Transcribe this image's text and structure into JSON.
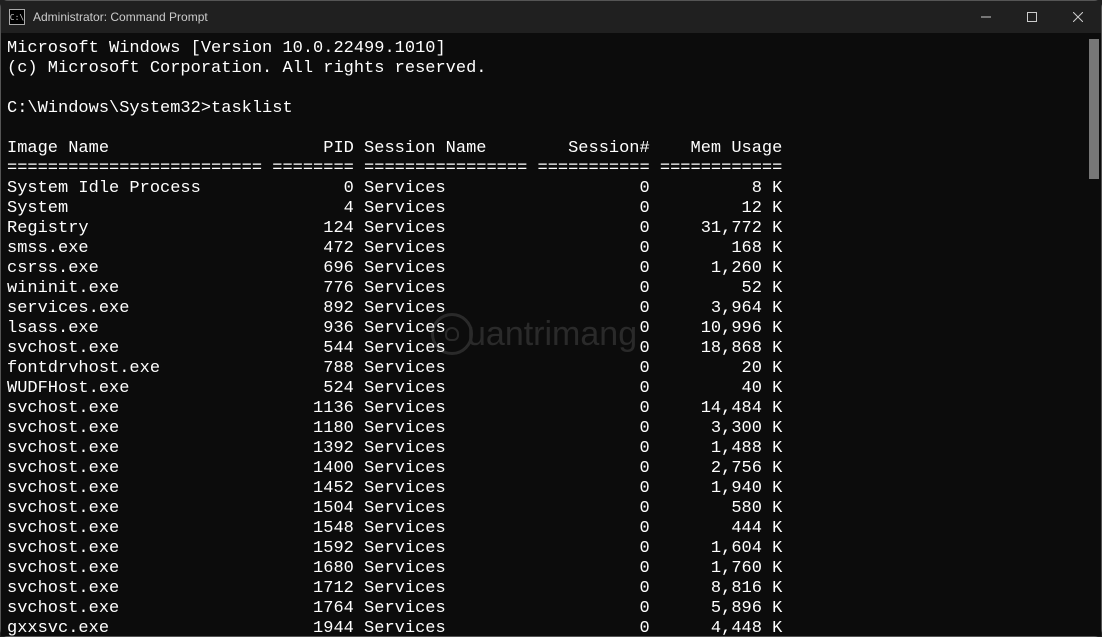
{
  "window": {
    "title": "Administrator: Command Prompt"
  },
  "lines": {
    "version": "Microsoft Windows [Version 10.0.22499.1010]",
    "copyright": "(c) Microsoft Corporation. All rights reserved.",
    "prompt": "C:\\Windows\\System32>",
    "command": "tasklist",
    "header1": "Image Name",
    "header2": "PID",
    "header3": "Session Name",
    "header4": "Session#",
    "header5": "Mem Usage"
  },
  "processes": [
    {
      "name": "System Idle Process",
      "pid": "0",
      "session": "Services",
      "snum": "0",
      "mem": "8 K"
    },
    {
      "name": "System",
      "pid": "4",
      "session": "Services",
      "snum": "0",
      "mem": "12 K"
    },
    {
      "name": "Registry",
      "pid": "124",
      "session": "Services",
      "snum": "0",
      "mem": "31,772 K"
    },
    {
      "name": "smss.exe",
      "pid": "472",
      "session": "Services",
      "snum": "0",
      "mem": "168 K"
    },
    {
      "name": "csrss.exe",
      "pid": "696",
      "session": "Services",
      "snum": "0",
      "mem": "1,260 K"
    },
    {
      "name": "wininit.exe",
      "pid": "776",
      "session": "Services",
      "snum": "0",
      "mem": "52 K"
    },
    {
      "name": "services.exe",
      "pid": "892",
      "session": "Services",
      "snum": "0",
      "mem": "3,964 K"
    },
    {
      "name": "lsass.exe",
      "pid": "936",
      "session": "Services",
      "snum": "0",
      "mem": "10,996 K"
    },
    {
      "name": "svchost.exe",
      "pid": "544",
      "session": "Services",
      "snum": "0",
      "mem": "18,868 K"
    },
    {
      "name": "fontdrvhost.exe",
      "pid": "788",
      "session": "Services",
      "snum": "0",
      "mem": "20 K"
    },
    {
      "name": "WUDFHost.exe",
      "pid": "524",
      "session": "Services",
      "snum": "0",
      "mem": "40 K"
    },
    {
      "name": "svchost.exe",
      "pid": "1136",
      "session": "Services",
      "snum": "0",
      "mem": "14,484 K"
    },
    {
      "name": "svchost.exe",
      "pid": "1180",
      "session": "Services",
      "snum": "0",
      "mem": "3,300 K"
    },
    {
      "name": "svchost.exe",
      "pid": "1392",
      "session": "Services",
      "snum": "0",
      "mem": "1,488 K"
    },
    {
      "name": "svchost.exe",
      "pid": "1400",
      "session": "Services",
      "snum": "0",
      "mem": "2,756 K"
    },
    {
      "name": "svchost.exe",
      "pid": "1452",
      "session": "Services",
      "snum": "0",
      "mem": "1,940 K"
    },
    {
      "name": "svchost.exe",
      "pid": "1504",
      "session": "Services",
      "snum": "0",
      "mem": "580 K"
    },
    {
      "name": "svchost.exe",
      "pid": "1548",
      "session": "Services",
      "snum": "0",
      "mem": "444 K"
    },
    {
      "name": "svchost.exe",
      "pid": "1592",
      "session": "Services",
      "snum": "0",
      "mem": "1,604 K"
    },
    {
      "name": "svchost.exe",
      "pid": "1680",
      "session": "Services",
      "snum": "0",
      "mem": "1,760 K"
    },
    {
      "name": "svchost.exe",
      "pid": "1712",
      "session": "Services",
      "snum": "0",
      "mem": "8,816 K"
    },
    {
      "name": "svchost.exe",
      "pid": "1764",
      "session": "Services",
      "snum": "0",
      "mem": "5,896 K"
    },
    {
      "name": "gxxsvc.exe",
      "pid": "1944",
      "session": "Services",
      "snum": "0",
      "mem": "4,448 K"
    }
  ],
  "watermark": {
    "text": "uantrimang"
  }
}
